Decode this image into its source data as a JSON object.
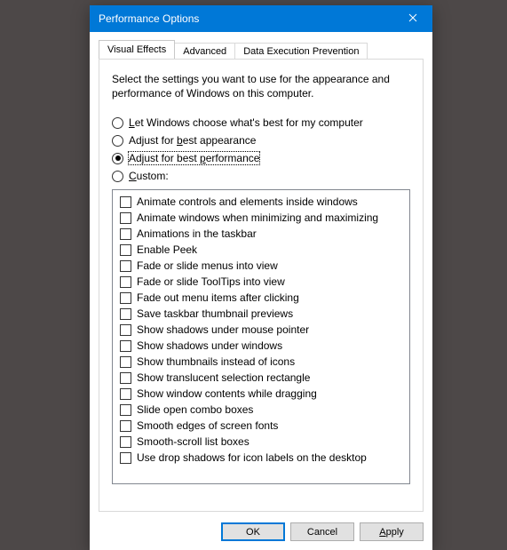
{
  "colors": {
    "accent": "#0078d7"
  },
  "title": "Performance Options",
  "tabs": [
    {
      "label": "Visual Effects",
      "active": true
    },
    {
      "label": "Advanced",
      "active": false
    },
    {
      "label": "Data Execution Prevention",
      "active": false
    }
  ],
  "description": "Select the settings you want to use for the appearance and performance of Windows on this computer.",
  "radios": [
    {
      "id": "let-windows",
      "label_html": "<u>L</u>et Windows choose what's best for my computer",
      "checked": false
    },
    {
      "id": "best-appearance",
      "label_html": "Adjust for <u>b</u>est appearance",
      "checked": false
    },
    {
      "id": "best-performance",
      "label_html": "Adjust for best <u>p</u>erformance",
      "checked": true,
      "focused": true
    },
    {
      "id": "custom",
      "label_html": "<u>C</u>ustom:",
      "checked": false
    }
  ],
  "options": [
    {
      "label": "Animate controls and elements inside windows",
      "checked": false
    },
    {
      "label": "Animate windows when minimizing and maximizing",
      "checked": false
    },
    {
      "label": "Animations in the taskbar",
      "checked": false
    },
    {
      "label": "Enable Peek",
      "checked": false
    },
    {
      "label": "Fade or slide menus into view",
      "checked": false
    },
    {
      "label": "Fade or slide ToolTips into view",
      "checked": false
    },
    {
      "label": "Fade out menu items after clicking",
      "checked": false
    },
    {
      "label": "Save taskbar thumbnail previews",
      "checked": false
    },
    {
      "label": "Show shadows under mouse pointer",
      "checked": false
    },
    {
      "label": "Show shadows under windows",
      "checked": false
    },
    {
      "label": "Show thumbnails instead of icons",
      "checked": false
    },
    {
      "label": "Show translucent selection rectangle",
      "checked": false
    },
    {
      "label": "Show window contents while dragging",
      "checked": false
    },
    {
      "label": "Slide open combo boxes",
      "checked": false
    },
    {
      "label": "Smooth edges of screen fonts",
      "checked": false
    },
    {
      "label": "Smooth-scroll list boxes",
      "checked": false
    },
    {
      "label": "Use drop shadows for icon labels on the desktop",
      "checked": false
    }
  ],
  "buttons": {
    "ok": "OK",
    "cancel": "Cancel",
    "apply_html": "<u>A</u>pply"
  }
}
